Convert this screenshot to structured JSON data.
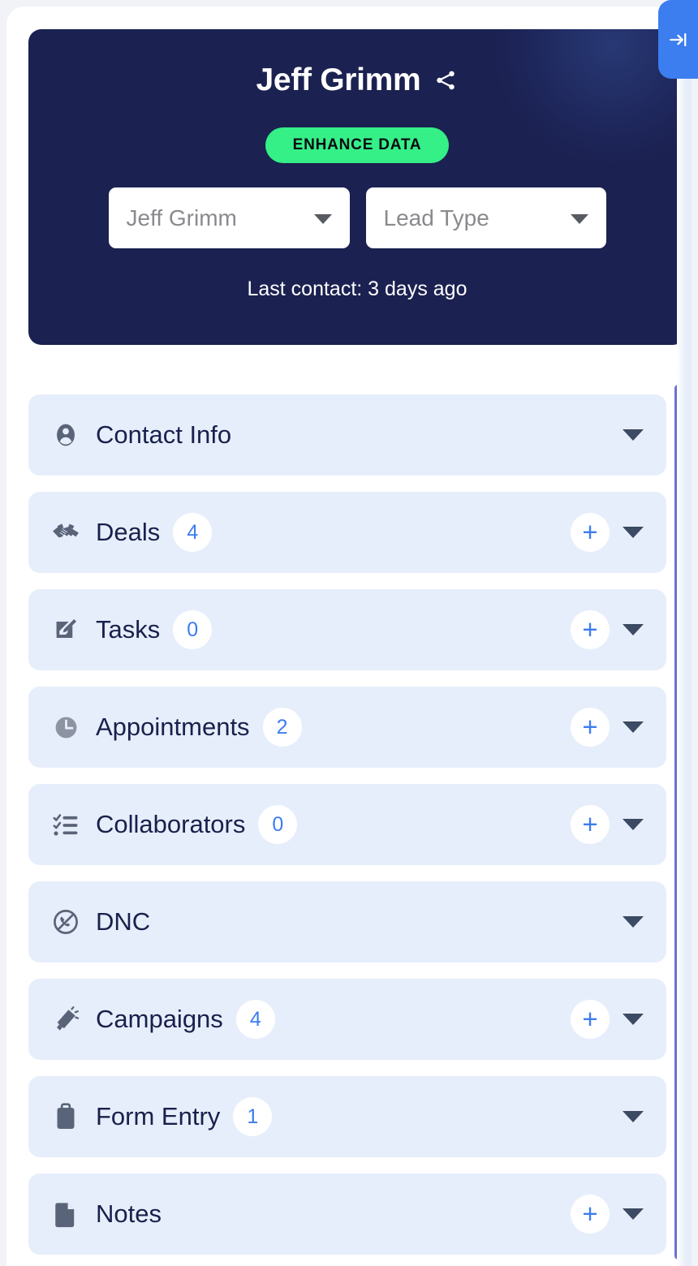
{
  "header": {
    "contact_name": "Jeff Grimm",
    "share_icon": "share-icon",
    "enhance_button": "ENHANCE DATA",
    "owner_select": {
      "value": "Jeff Grimm",
      "caret": "chevron-down-icon"
    },
    "lead_type_select": {
      "value": "Lead Type",
      "caret": "chevron-down-icon"
    },
    "last_contact": "Last contact: 3 days ago",
    "collapse_tab_icon": "arrow-right-to-line-icon",
    "colors": {
      "card_bg": "#1B2150",
      "enhance_bg": "#35EF87",
      "enhance_text": "#0A0A12",
      "accent_blue": "#3C7DF0"
    }
  },
  "sections": [
    {
      "label": "Contact Info",
      "icon": "user-circle-icon",
      "count": null,
      "has_add": false,
      "add_label": "+",
      "caret": "chevron-down-icon"
    },
    {
      "label": "Deals",
      "icon": "handshake-icon",
      "count": "4",
      "has_add": true,
      "add_label": "+",
      "caret": "chevron-down-icon"
    },
    {
      "label": "Tasks",
      "icon": "pencil-square-icon",
      "count": "0",
      "has_add": true,
      "add_label": "+",
      "caret": "chevron-down-icon"
    },
    {
      "label": "Appointments",
      "icon": "clock-icon",
      "count": "2",
      "has_add": true,
      "add_label": "+",
      "caret": "chevron-down-icon"
    },
    {
      "label": "Collaborators",
      "icon": "checklist-icon",
      "count": "0",
      "has_add": true,
      "add_label": "+",
      "caret": "chevron-down-icon"
    },
    {
      "label": "DNC",
      "icon": "do-not-call-icon",
      "count": null,
      "has_add": false,
      "add_label": "+",
      "caret": "chevron-down-icon"
    },
    {
      "label": "Campaigns",
      "icon": "megaphone-icon",
      "count": "4",
      "has_add": true,
      "add_label": "+",
      "caret": "chevron-down-icon"
    },
    {
      "label": "Form Entry",
      "icon": "clipboard-icon",
      "count": "1",
      "has_add": false,
      "add_label": "+",
      "caret": "chevron-down-icon"
    },
    {
      "label": "Notes",
      "icon": "document-icon",
      "count": null,
      "has_add": true,
      "add_label": "+",
      "caret": "chevron-down-icon"
    }
  ],
  "scrollbar": {
    "color": "#6B70D8"
  }
}
